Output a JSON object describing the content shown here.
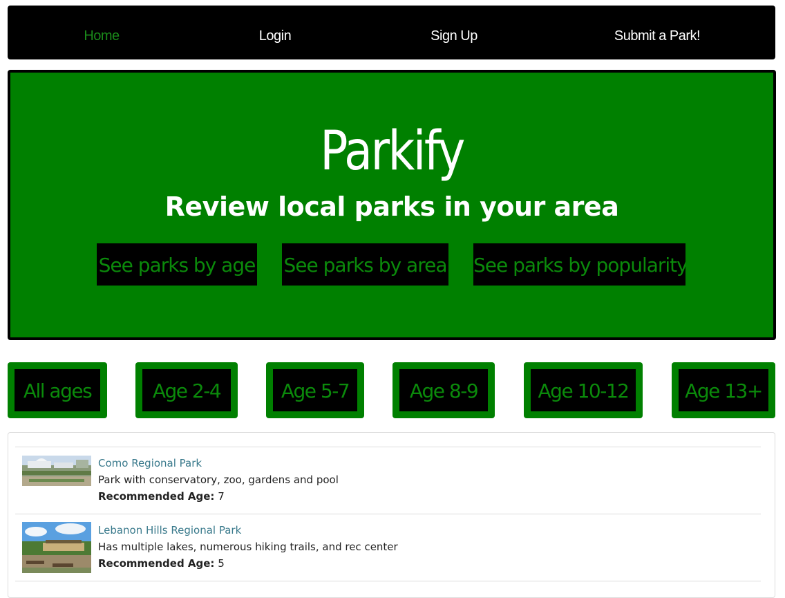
{
  "nav": {
    "items": [
      {
        "label": "Home",
        "active": true
      },
      {
        "label": "Login",
        "active": false
      },
      {
        "label": "Sign Up",
        "active": false
      },
      {
        "label": "Submit a Park!",
        "active": false
      }
    ]
  },
  "hero": {
    "title": "Parkify",
    "subtitle": "Review local parks in your area",
    "buttons": [
      "See parks by age",
      "See parks by area",
      "See parks by popularity"
    ]
  },
  "age_filters": [
    "All ages",
    "Age 2-4",
    "Age 5-7",
    "Age 8-9",
    "Age 10-12",
    "Age 13+"
  ],
  "parks": [
    {
      "name": "Como Regional Park",
      "description": "Park with conservatory, zoo, gardens and pool",
      "age_label": "Recommended Age:",
      "age": "7"
    },
    {
      "name": "Lebanon Hills Regional Park",
      "description": "Has multiple lakes, numerous hiking trails, and rec center",
      "age_label": "Recommended Age:",
      "age": "5"
    }
  ],
  "colors": {
    "brand_green": "#008000",
    "active_text": "#0b8a0b",
    "link": "#3a7a8c"
  }
}
